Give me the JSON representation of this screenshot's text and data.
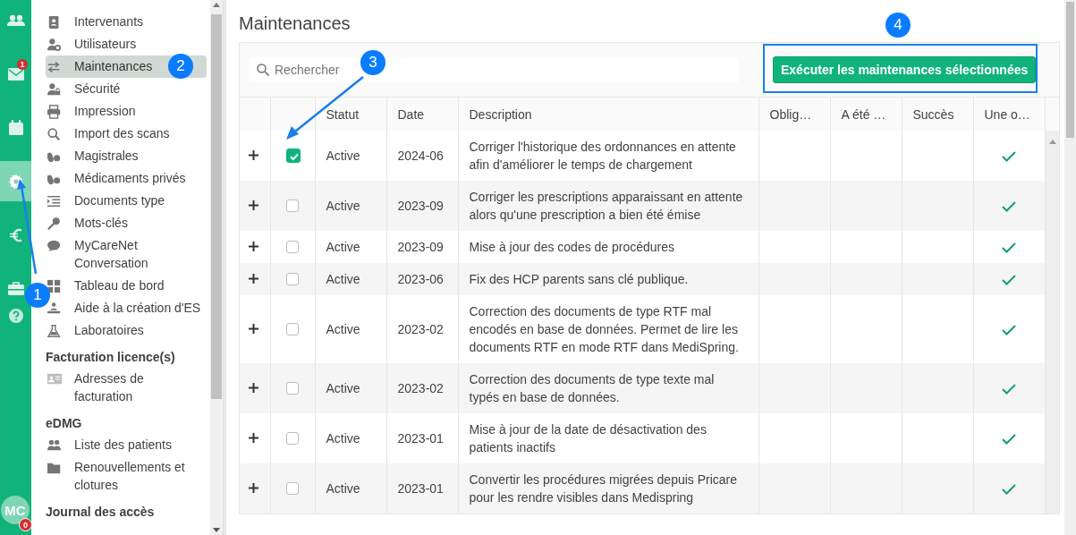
{
  "rail": {
    "items": [
      {
        "selected": false
      },
      {
        "selected": false,
        "badge": "1"
      },
      {
        "selected": false
      },
      {
        "selected": true
      },
      {
        "selected": false
      },
      {
        "selected": false
      },
      {
        "selected": false
      }
    ],
    "avatar": {
      "initials": "MC",
      "badge": "0"
    }
  },
  "sidebar": {
    "sections": [
      {
        "items": [
          {
            "label": "Intervenants",
            "selected": false
          },
          {
            "label": "Utilisateurs",
            "selected": false
          },
          {
            "label": "Maintenances",
            "selected": true
          },
          {
            "label": "Sécurité",
            "selected": false
          },
          {
            "label": "Impression",
            "selected": false
          },
          {
            "label": "Import des scans",
            "selected": false
          },
          {
            "label": "Magistrales",
            "selected": false
          },
          {
            "label": "Médicaments privés",
            "selected": false
          },
          {
            "label": "Documents type",
            "selected": false
          },
          {
            "label": "Mots-clés",
            "selected": false
          },
          {
            "label": "MyCareNet Conversation",
            "selected": false
          },
          {
            "label": "Tableau de bord",
            "selected": false
          },
          {
            "label": "Aide à la création d'ES",
            "selected": false
          },
          {
            "label": "Laboratoires",
            "selected": false
          }
        ]
      },
      {
        "heading": "Facturation licence(s)",
        "items": [
          {
            "label": "Adresses de facturation",
            "selected": false
          }
        ]
      },
      {
        "heading": "eDMG",
        "items": [
          {
            "label": "Liste des patients",
            "selected": false
          },
          {
            "label": "Renouvellements et clotures",
            "selected": false
          }
        ]
      },
      {
        "heading": "Journal des accès"
      }
    ]
  },
  "page": {
    "title": "Maintenances"
  },
  "search": {
    "placeholder": "Rechercher"
  },
  "run_button": "Exécuter les maintenances sélectionnées",
  "table": {
    "columns": [
      "Statut",
      "Date",
      "Description",
      "Oblig…",
      "A été …",
      "Succès",
      "Une o…"
    ],
    "rows": [
      {
        "selected": true,
        "status": "Active",
        "date": "2024-06",
        "description": "Corriger l'historique des ordonnances en attente afin d'améliorer le temps de chargement",
        "check": true
      },
      {
        "selected": false,
        "status": "Active",
        "date": "2023-09",
        "description": "Corriger les prescriptions apparaissant en attente alors qu'une prescription a bien été émise",
        "check": true
      },
      {
        "selected": false,
        "status": "Active",
        "date": "2023-09",
        "description": "Mise à jour des codes de procédures",
        "check": true
      },
      {
        "selected": false,
        "status": "Active",
        "date": "2023-06",
        "description": "Fix des HCP parents sans clé publique.",
        "check": true
      },
      {
        "selected": false,
        "status": "Active",
        "date": "2023-02",
        "description": "Correction des documents de type RTF mal encodés en base de données. Permet de lire les documents RTF en mode RTF dans MediSpring.",
        "check": true
      },
      {
        "selected": false,
        "status": "Active",
        "date": "2023-02",
        "description": "Correction des documents de type texte mal typés en base de données.",
        "check": true
      },
      {
        "selected": false,
        "status": "Active",
        "date": "2023-01",
        "description": "Mise à jour de la date de désactivation des patients inactifs",
        "check": true
      },
      {
        "selected": false,
        "status": "Active",
        "date": "2023-01",
        "description": "Convertir les procédures migrées depuis Pricare pour les rendre visibles dans Medispring",
        "check": true
      }
    ]
  },
  "annotations": [
    {
      "label": "1"
    },
    {
      "label": "2"
    },
    {
      "label": "3"
    },
    {
      "label": "4"
    }
  ]
}
